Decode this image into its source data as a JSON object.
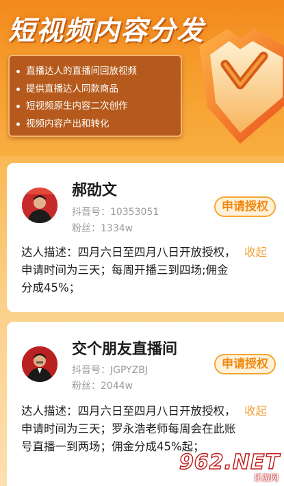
{
  "banner": {
    "title": "短视频内容分发",
    "features": [
      "直播达人的直播间回放视频",
      "提供直播达人同款商品",
      "短视频原生内容二次创作",
      "视频内容产出和转化"
    ]
  },
  "creators": [
    {
      "name": "郝劭文",
      "id_label": "抖音号：",
      "id_value": "10353051",
      "fans_label": "粉丝：",
      "fans_value": "1334w",
      "apply_label": "申请授权",
      "desc_label": "达人描述：",
      "desc_text": "四月六日至四月八日开放授权，申请时间为三天；每周开播三到四场;佣金分成45%；",
      "collapse_label": "收起"
    },
    {
      "name": "交个朋友直播间",
      "id_label": "抖音号：",
      "id_value": "JGPYZBJ",
      "fans_label": "粉丝：",
      "fans_value": "2044w",
      "apply_label": "申请授权",
      "desc_label": "达人描述：",
      "desc_text": "四月六日至四月八日开放授权，申请时间为三天；罗永浩老师每周会在此账号直播一到两场；佣金分成45%起；",
      "collapse_label": "收起"
    }
  ],
  "watermark": {
    "big": "962.NET",
    "small": "乐游网"
  },
  "colors": {
    "accent": "#f18a12",
    "collapse": "#f2a037",
    "feature_box": "#b55a1c"
  }
}
